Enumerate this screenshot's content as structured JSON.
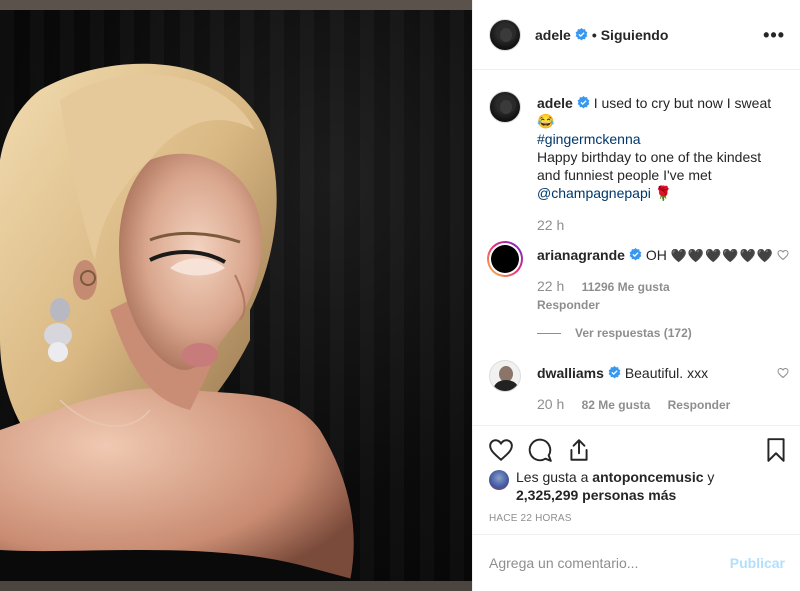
{
  "post": {
    "username": "adele",
    "follow_status": "Siguiendo",
    "more_label": "•••"
  },
  "caption": {
    "username": "adele",
    "text": "I used to cry but now I sweat",
    "emoji": "😂",
    "hashtag": "#gingermckenna",
    "line2": "Happy birthday to one of the kindest and funniest people I've met",
    "mention": "@champagnepapi",
    "rose": "🌹",
    "time": "22 h"
  },
  "comments": [
    {
      "username": "arianagrande",
      "text": "OH",
      "hearts": "🖤🖤🖤🖤🖤🖤",
      "time": "22 h",
      "likes": "11296 Me gusta",
      "reply": "Responder",
      "view_replies": "Ver respuestas (172)"
    },
    {
      "username": "dwalliams",
      "text": "Beautiful. xxx",
      "time": "20 h",
      "likes": "82 Me gusta",
      "reply": "Responder"
    }
  ],
  "likes": {
    "prefix": "Les gusta a",
    "user": "antoponcemusic",
    "conj": "y",
    "count": "2,325,299 personas más"
  },
  "timestamp": "HACE 22 HORAS",
  "add_comment": {
    "placeholder": "Agrega un comentario...",
    "publish": "Publicar"
  },
  "colors": {
    "verified": "#3897f0",
    "link": "#00376b",
    "muted": "#8e8e8e",
    "publish_disabled": "#b2dffc"
  }
}
